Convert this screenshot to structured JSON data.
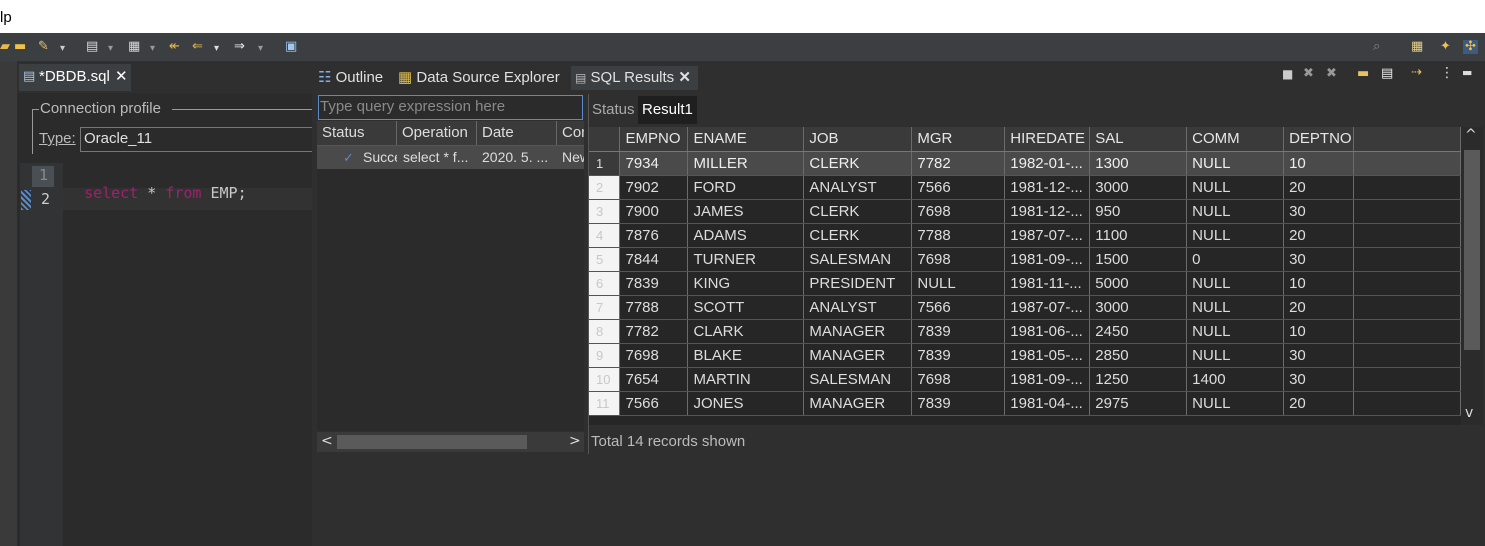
{
  "menubar": {
    "visible_text": "lp"
  },
  "toolbar": {
    "left_icons": [
      "open-icon",
      "folder-icon",
      "brush-icon",
      "dropdown-icon",
      "save-icon",
      "dropdown-icon",
      "doc-icon",
      "dropdown-icon",
      "back-icon",
      "arrow-left-icon",
      "dropdown-icon",
      "arrow-right-icon",
      "dropdown-icon",
      "new-window-icon"
    ],
    "right_icons": [
      "search-icon",
      "perspective-icon",
      "perspective-alt-icon",
      "debug-icon"
    ]
  },
  "editor": {
    "tab_label": "*DBDB.sql",
    "connection_group_label": "Connection profile",
    "type_label": "Type:",
    "type_value": "Oracle_11",
    "lines": [
      {
        "num": "1",
        "tokens": [
          {
            "text": "select",
            "kind": "kw"
          },
          {
            "text": " * ",
            "kind": "plain"
          },
          {
            "text": "from",
            "kind": "kw"
          },
          {
            "text": " EMP;",
            "kind": "plain"
          }
        ]
      },
      {
        "num": "2",
        "tokens": []
      }
    ]
  },
  "panel": {
    "tabs": [
      {
        "label": "Outline",
        "icon": "outline-icon"
      },
      {
        "label": "Data Source Explorer",
        "icon": "database-icon"
      },
      {
        "label": "SQL Results",
        "icon": "results-icon",
        "active": true
      }
    ],
    "query_placeholder": "Type query expression here",
    "history_columns": [
      "Status",
      "Operation",
      "Date",
      "Con"
    ],
    "history_rows": [
      {
        "status": "Succe",
        "operation": "select * f...",
        "date": "2020. 5. ...",
        "connection": "New"
      }
    ],
    "result_tabs": [
      "Status",
      "Result1"
    ],
    "columns": [
      "EMPNO",
      "ENAME",
      "JOB",
      "MGR",
      "HIREDATE",
      "SAL",
      "COMM",
      "DEPTNO"
    ],
    "rows": [
      [
        "1",
        "7934",
        "MILLER",
        "CLERK",
        "7782",
        "1982-01-...",
        "1300",
        "NULL",
        "10"
      ],
      [
        "2",
        "7902",
        "FORD",
        "ANALYST",
        "7566",
        "1981-12-...",
        "3000",
        "NULL",
        "20"
      ],
      [
        "3",
        "7900",
        "JAMES",
        "CLERK",
        "7698",
        "1981-12-...",
        "950",
        "NULL",
        "30"
      ],
      [
        "4",
        "7876",
        "ADAMS",
        "CLERK",
        "7788",
        "1987-07-...",
        "1100",
        "NULL",
        "20"
      ],
      [
        "5",
        "7844",
        "TURNER",
        "SALESMAN",
        "7698",
        "1981-09-...",
        "1500",
        "0",
        "30"
      ],
      [
        "6",
        "7839",
        "KING",
        "PRESIDENT",
        "NULL",
        "1981-11-...",
        "5000",
        "NULL",
        "10"
      ],
      [
        "7",
        "7788",
        "SCOTT",
        "ANALYST",
        "7566",
        "1987-07-...",
        "3000",
        "NULL",
        "20"
      ],
      [
        "8",
        "7782",
        "CLARK",
        "MANAGER",
        "7839",
        "1981-06-...",
        "2450",
        "NULL",
        "10"
      ],
      [
        "9",
        "7698",
        "BLAKE",
        "MANAGER",
        "7839",
        "1981-05-...",
        "2850",
        "NULL",
        "30"
      ],
      [
        "10",
        "7654",
        "MARTIN",
        "SALESMAN",
        "7698",
        "1981-09-...",
        "1250",
        "1400",
        "30"
      ],
      [
        "11",
        "7566",
        "JONES",
        "MANAGER",
        "7839",
        "1981-04-...",
        "2975",
        "NULL",
        "20"
      ]
    ],
    "status_text": "Total 14 records shown",
    "toolbar_icons": [
      "stop-icon",
      "remove-icon",
      "remove-all-icon",
      "view-icon",
      "doc-icon",
      "export-icon",
      "menu-icon",
      "minimize-icon"
    ]
  },
  "colors": {
    "keyword": "#cc7832",
    "keyword_sql": "#a0206e",
    "selection": "#4a4a4a",
    "accent_border": "#5a8ac8"
  }
}
